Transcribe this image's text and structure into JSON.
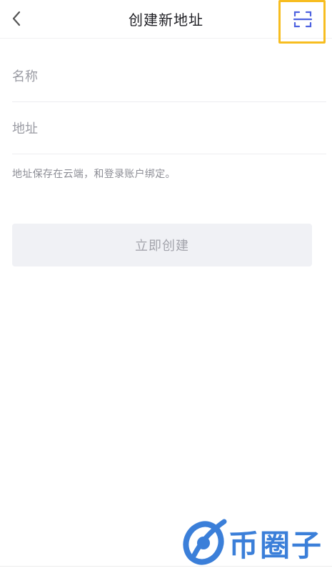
{
  "header": {
    "title": "创建新地址",
    "back_icon": "chevron-left-icon",
    "scan_icon": "scan-icon",
    "scan_highlight_color": "#f7bd20",
    "scan_icon_color": "#4e62e0"
  },
  "form": {
    "name_placeholder": "名称",
    "address_placeholder": "地址",
    "hint": "地址保存在云端，和登录账户绑定。"
  },
  "actions": {
    "create_label": "立即创建"
  },
  "watermark": {
    "text": "币圈子",
    "color": "#3b7fd9"
  }
}
